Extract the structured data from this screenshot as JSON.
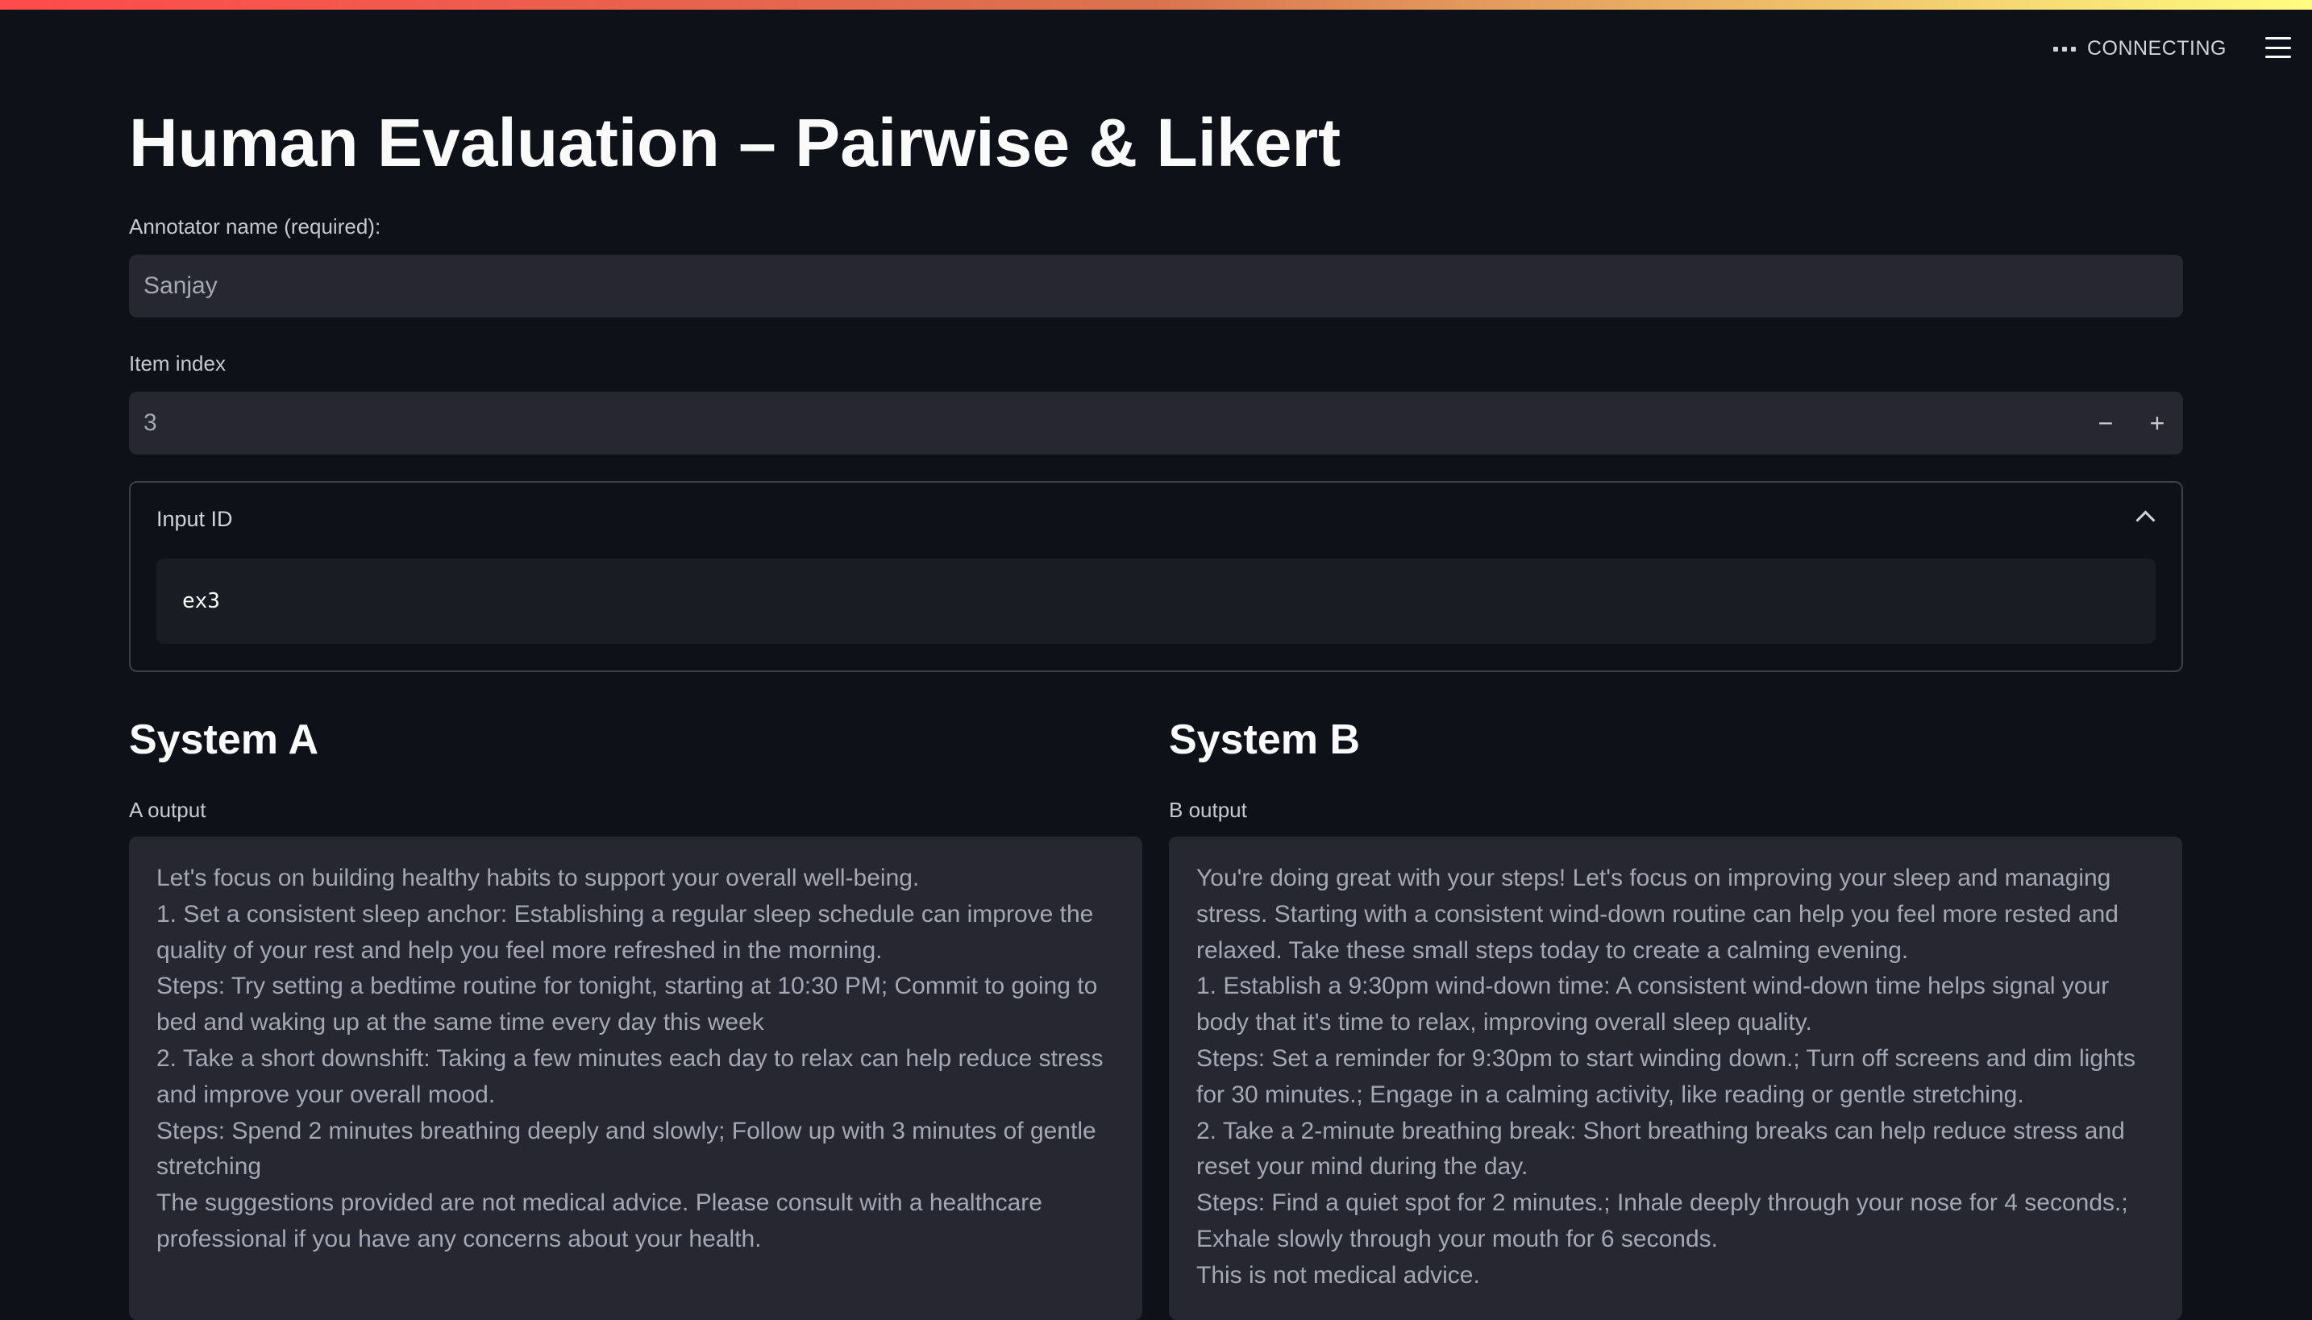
{
  "header": {
    "status_text": "CONNECTING"
  },
  "page": {
    "title": "Human Evaluation – Pairwise & Likert"
  },
  "annotator": {
    "label": "Annotator name (required):",
    "value": "Sanjay"
  },
  "item_index": {
    "label": "Item index",
    "value": "3",
    "decrement_symbol": "−",
    "increment_symbol": "+"
  },
  "input_id": {
    "header": "Input ID",
    "value": "ex3"
  },
  "system_a": {
    "heading": "System A",
    "output_label": "A output",
    "output_lines": [
      "Let's focus on building healthy habits to support your overall well-being.",
      "1. Set a consistent sleep anchor: Establishing a regular sleep schedule can improve the quality of your rest and help you feel more refreshed in the morning.",
      "Steps: Try setting a bedtime routine for tonight, starting at 10:30 PM; Commit to going to bed and waking up at the same time every day this week",
      "2. Take a short downshift: Taking a few minutes each day to relax can help reduce stress and improve your overall mood.",
      "Steps: Spend 2 minutes breathing deeply and slowly; Follow up with 3 minutes of gentle stretching",
      "The suggestions provided are not medical advice. Please consult with a healthcare professional if you have any concerns about your health."
    ]
  },
  "system_b": {
    "heading": "System B",
    "output_label": "B output",
    "output_lines": [
      "You're doing great with your steps! Let's focus on improving your sleep and managing stress. Starting with a consistent wind-down routine can help you feel more rested and relaxed. Take these small steps today to create a calming evening.",
      "1. Establish a 9:30pm wind-down time: A consistent wind-down time helps signal your body that it's time to relax, improving overall sleep quality.",
      "Steps: Set a reminder for 9:30pm to start winding down.; Turn off screens and dim lights for 30 minutes.; Engage in a calming activity, like reading or gentle stretching.",
      "2. Take a 2-minute breathing break: Short breathing breaks can help reduce stress and reset your mind during the day.",
      "Steps: Find a quiet spot for 2 minutes.; Inhale deeply through your nose for 4 seconds.; Exhale slowly through your mouth for 6 seconds.",
      "This is not medical advice."
    ]
  },
  "colors": {
    "background": "#0e1117",
    "input_background": "#262730",
    "text_primary": "#fafafa",
    "text_muted": "#a3a8b4"
  }
}
